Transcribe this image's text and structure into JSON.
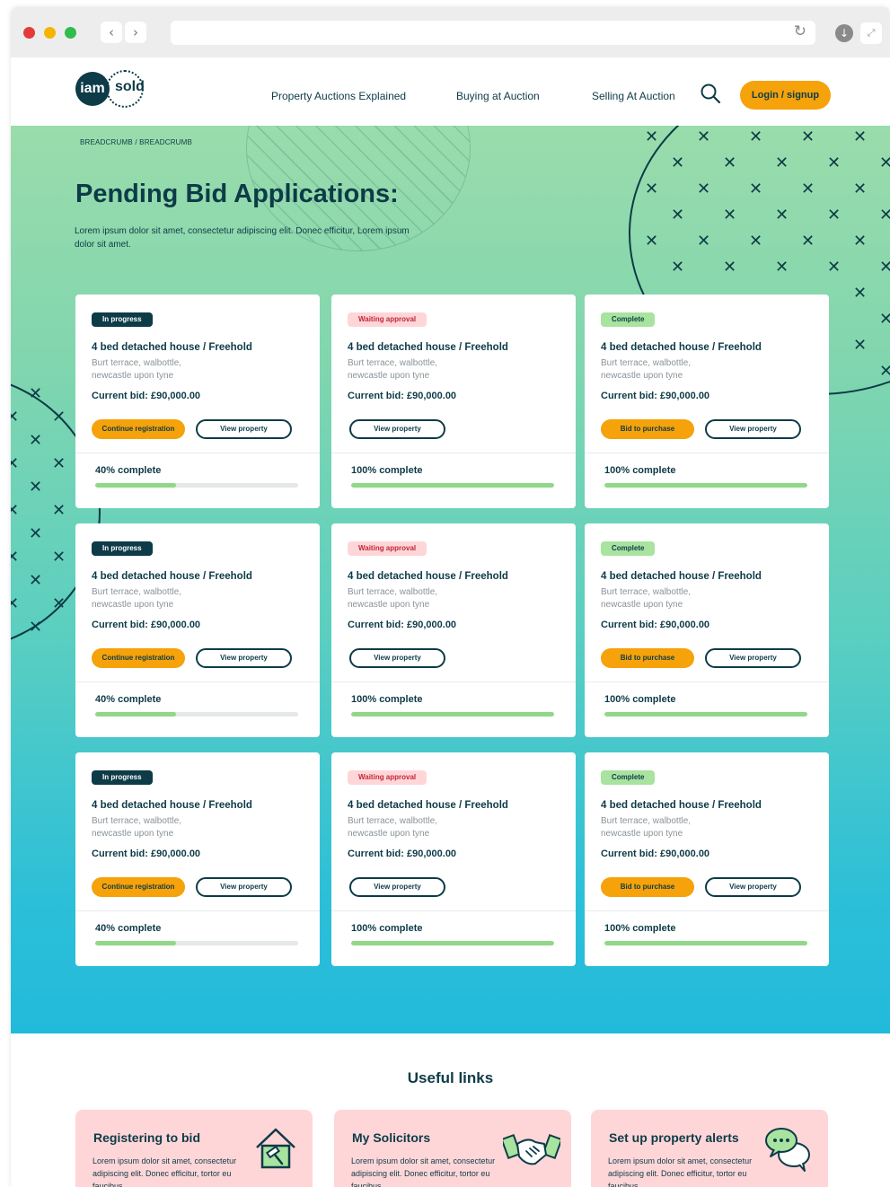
{
  "browser": {
    "back_icon": "‹",
    "forward_icon": "›",
    "reload_icon": "↻",
    "download_icon": "↓",
    "expand_icon": "⤢"
  },
  "header": {
    "logo_iam": "iam",
    "logo_sold": "sold",
    "nav": [
      "Property Auctions Explained",
      "Buying at Auction",
      "Selling At Auction"
    ],
    "login_label": "Login / signup"
  },
  "hero": {
    "breadcrumb": "BREADCRUMB / BREADCRUMB",
    "title": "Pending Bid Applications:",
    "intro": "Lorem ipsum dolor sit amet, consectetur adipiscing elit. Donec efficitur, Lorem ipsum dolor sit amet."
  },
  "cards": [
    {
      "status": "In progress",
      "status_type": "progress",
      "title": "4 bed detached house / Freehold",
      "address": "Burt terrace, walbottle, newcastle upon tyne",
      "bid": "Current bid: £90,000.00",
      "primary": "Continue registration",
      "secondary": "View property",
      "progress_label": "40% complete",
      "progress": 0.4
    },
    {
      "status": "Waiting approval",
      "status_type": "waiting",
      "title": "4 bed detached house / Freehold",
      "address": "Burt terrace, walbottle, newcastle upon tyne",
      "bid": "Current bid: £90,000.00",
      "primary": "",
      "secondary": "View property",
      "progress_label": "100% complete",
      "progress": 1.0
    },
    {
      "status": "Complete",
      "status_type": "complete",
      "title": "4 bed detached house / Freehold",
      "address": "Burt terrace, walbottle, newcastle upon tyne",
      "bid": "Current bid: £90,000.00",
      "primary": "Bid to purchase",
      "secondary": "View property",
      "progress_label": "100% complete",
      "progress": 1.0
    },
    {
      "status": "In progress",
      "status_type": "progress",
      "title": "4 bed detached house / Freehold",
      "address": "Burt terrace, walbottle, newcastle upon tyne",
      "bid": "Current bid: £90,000.00",
      "primary": "Continue registration",
      "secondary": "View property",
      "progress_label": "40% complete",
      "progress": 0.4
    },
    {
      "status": "Waiting approval",
      "status_type": "waiting",
      "title": "4 bed detached house / Freehold",
      "address": "Burt terrace, walbottle, newcastle upon tyne",
      "bid": "Current bid: £90,000.00",
      "primary": "",
      "secondary": "View property",
      "progress_label": "100% complete",
      "progress": 1.0
    },
    {
      "status": "Complete",
      "status_type": "complete",
      "title": "4 bed detached house / Freehold",
      "address": "Burt terrace, walbottle, newcastle upon tyne",
      "bid": "Current bid: £90,000.00",
      "primary": "Bid to purchase",
      "secondary": "View property",
      "progress_label": "100% complete",
      "progress": 1.0
    },
    {
      "status": "In progress",
      "status_type": "progress",
      "title": "4 bed detached house / Freehold",
      "address": "Burt terrace, walbottle, newcastle upon tyne",
      "bid": "Current bid: £90,000.00",
      "primary": "Continue registration",
      "secondary": "View property",
      "progress_label": "40% complete",
      "progress": 0.4
    },
    {
      "status": "Waiting approval",
      "status_type": "waiting",
      "title": "4 bed detached house / Freehold",
      "address": "Burt terrace, walbottle, newcastle upon tyne",
      "bid": "Current bid: £90,000.00",
      "primary": "",
      "secondary": "View property",
      "progress_label": "100% complete",
      "progress": 1.0
    },
    {
      "status": "Complete",
      "status_type": "complete",
      "title": "4 bed detached house / Freehold",
      "address": "Burt terrace, walbottle, newcastle upon tyne",
      "bid": "Current bid: £90,000.00",
      "primary": "Bid to purchase",
      "secondary": "View property",
      "progress_label": "100% complete",
      "progress": 1.0
    }
  ],
  "useful_links": {
    "title": "Useful links",
    "items": [
      {
        "title": "Registering to bid",
        "text": "Lorem ipsum dolor sit amet, consectetur adipiscing elit. Donec efficitur, tortor eu faucibus",
        "icon": "house-gavel-icon"
      },
      {
        "title": "My Solicitors",
        "text": "Lorem ipsum dolor sit amet, consectetur adipiscing elit. Donec efficitur, tortor eu faucibus",
        "icon": "handshake-icon"
      },
      {
        "title": "Set up property alerts",
        "text": "Lorem ipsum dolor sit amet, consectetur adipiscing elit. Donec efficitur, tortor eu faucibus",
        "icon": "chat-bubbles-icon"
      }
    ]
  },
  "colors": {
    "navy": "#0d3b47",
    "orange": "#f5a20b",
    "green_fill": "#90d887",
    "pink": "#ffd6d8"
  }
}
